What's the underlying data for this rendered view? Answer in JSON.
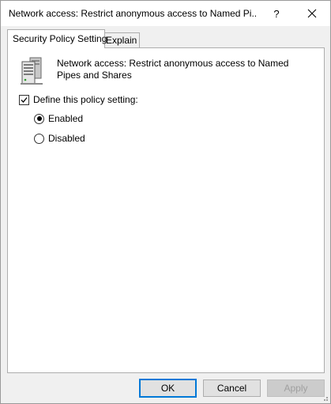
{
  "window": {
    "title": "Network access: Restrict anonymous access to Named Pi...",
    "help_label": "?"
  },
  "tabs": [
    {
      "label": "Security Policy Setting",
      "active": true
    },
    {
      "label": "Explain",
      "active": false
    }
  ],
  "policy": {
    "icon": "server-policy-icon",
    "description": "Network access: Restrict anonymous access to Named Pipes and Shares",
    "define_label": "Define this policy setting:",
    "define_checked": true,
    "options": [
      {
        "label": "Enabled",
        "selected": true
      },
      {
        "label": "Disabled",
        "selected": false
      }
    ]
  },
  "buttons": {
    "ok": "OK",
    "cancel": "Cancel",
    "apply": "Apply"
  },
  "colors": {
    "accent": "#0078d7",
    "button_bg": "#e1e1e1",
    "disabled_text": "#a0a0a0"
  }
}
